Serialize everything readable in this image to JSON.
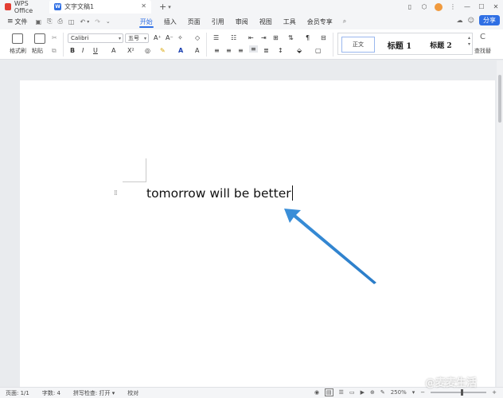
{
  "tabs": {
    "app_tab": "WPS Office",
    "doc_tab": "文字文稿1",
    "doc_logo": "W"
  },
  "menubar": {
    "file_label": "文件",
    "items": [
      "开始",
      "插入",
      "页面",
      "引用",
      "审阅",
      "视图",
      "工具",
      "会员专享"
    ],
    "active": "开始",
    "share_label": "分享"
  },
  "ribbon": {
    "format_painter": "格式刷",
    "paste": "粘贴",
    "font_name": "Calibri",
    "font_size": "五号",
    "styles": [
      "正文",
      "标题 1",
      "标题 2"
    ],
    "find_replace": "查找替"
  },
  "document": {
    "text": "tomorrow will be better"
  },
  "statusbar": {
    "page": "页面: 1/1",
    "words": "字数: 4",
    "spellcheck": "拼写检查: 打开",
    "proofread": "校对",
    "zoom": "250%"
  },
  "watermark": "@麦麦生活",
  "colors": {
    "accent": "#2f6fe4",
    "wps_red": "#e33e33",
    "annotation_arrow": "#3a8fd9"
  }
}
